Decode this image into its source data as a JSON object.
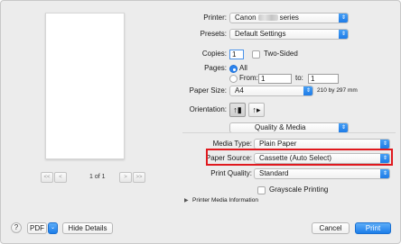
{
  "pager": {
    "first": "<<",
    "prev": "<",
    "label": "1 of 1",
    "next": ">",
    "last": ">>"
  },
  "printer": {
    "label": "Printer:",
    "value_prefix": "Canon",
    "value_suffix": "series"
  },
  "presets": {
    "label": "Presets:",
    "value": "Default Settings"
  },
  "copies": {
    "label": "Copies:",
    "value": "1",
    "two_sided_label": "Two-Sided"
  },
  "pages": {
    "label": "Pages:",
    "all_label": "All",
    "from_label": "From:",
    "from_value": "1",
    "to_label": "to:",
    "to_value": "1",
    "selected": "All"
  },
  "paper_size": {
    "label": "Paper Size:",
    "value": "A4",
    "dimensions": "210 by 297 mm"
  },
  "orientation": {
    "label": "Orientation:",
    "portrait_glyph": "↑👤",
    "landscape_glyph": "↑▶",
    "selected": "portrait"
  },
  "section": {
    "value": "Quality & Media"
  },
  "media_type": {
    "label": "Media Type:",
    "value": "Plain Paper"
  },
  "paper_source": {
    "label": "Paper Source:",
    "value": "Cassette (Auto Select)"
  },
  "print_quality": {
    "label": "Print Quality:",
    "value": "Standard"
  },
  "grayscale": {
    "label": "Grayscale Printing",
    "checked": false
  },
  "printer_media_info": {
    "label": "Printer Media Information"
  },
  "footer": {
    "help": "?",
    "pdf_label": "PDF",
    "hide_details": "Hide Details",
    "cancel": "Cancel",
    "print": "Print"
  },
  "colors": {
    "accent": "#1c7de9",
    "highlight": "#e0191e"
  }
}
